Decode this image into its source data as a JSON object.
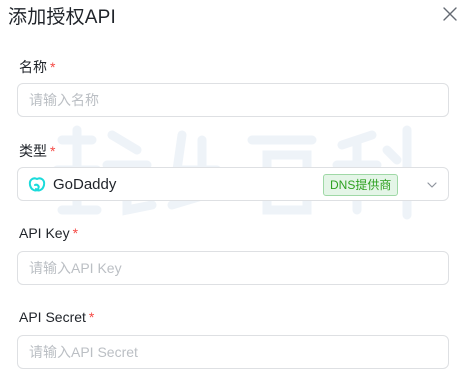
{
  "dialog": {
    "title": "添加授权API"
  },
  "fields": {
    "name": {
      "label": "名称",
      "required_mark": "*",
      "placeholder": "请输入名称",
      "value": ""
    },
    "type": {
      "label": "类型",
      "required_mark": "*",
      "selected": {
        "icon": "godaddy-logo-icon",
        "value": "GoDaddy",
        "badge": "DNS提供商"
      }
    },
    "api_key": {
      "label": "API Key",
      "required_mark": "*",
      "placeholder": "请输入API Key",
      "value": ""
    },
    "api_secret": {
      "label": "API Secret",
      "required_mark": "*",
      "placeholder": "请输入API Secret",
      "value": ""
    }
  },
  "colors": {
    "required": "#f54a45",
    "badge_text": "#2ea121",
    "badge_bg": "#e4f5e7",
    "godaddy_icon": "#1bdbdb"
  }
}
